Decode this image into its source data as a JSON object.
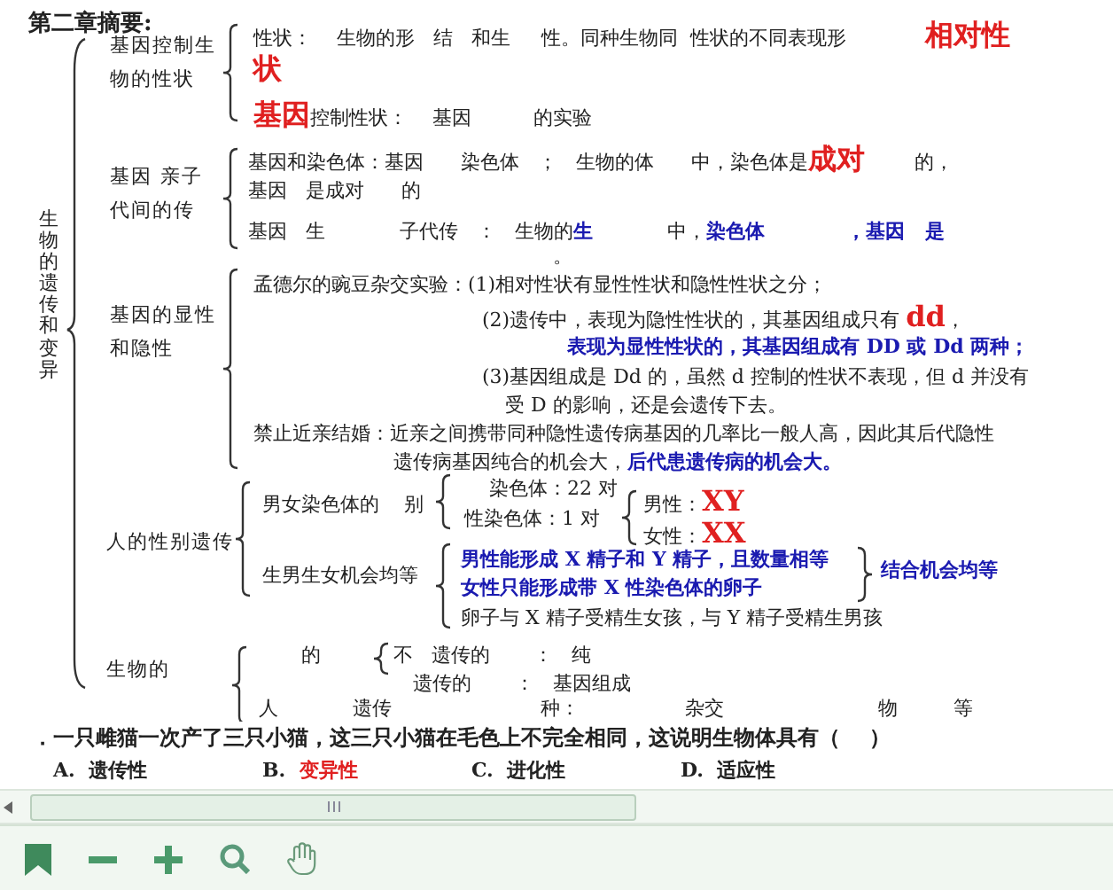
{
  "title": "第二章摘要:",
  "topic": "生物的遗传和变异",
  "sections": [
    {
      "label": "基因控制生物的性状",
      "lines": [
        [
          {
            "text": "性状：    生物的形   结   和生     性。同种生物同  性状的不同表现形",
            "kind": "text"
          },
          {
            "text": "        相对性",
            "kind": "key"
          }
        ],
        [
          {
            "text": "状",
            "kind": "key"
          }
        ],
        [
          {
            "text": "基因",
            "kind": "key"
          },
          {
            "text": "控制性状：    基因          的实验",
            "kind": "text"
          }
        ]
      ]
    },
    {
      "label": "基因  亲子代间的传",
      "lines": [
        [
          {
            "text": "基因和染色体：基因      染色体   ；   生物的体      中，染色体是",
            "kind": "text"
          },
          {
            "text": "成对",
            "kind": "key"
          },
          {
            "text": "        的，",
            "kind": "text"
          }
        ],
        [
          {
            "text": "基因   是成对      的",
            "kind": "text"
          }
        ],
        [
          {
            "text": "基因   生            子代传   ：   生物的",
            "kind": "text"
          },
          {
            "text": "生",
            "kind": "note"
          },
          {
            "text": "            中，",
            "kind": "text"
          },
          {
            "text": "染色体",
            "kind": "note"
          },
          {
            "text": "            ，基因   是",
            "kind": "note"
          }
        ],
        [
          {
            "text": "。",
            "kind": "text"
          }
        ]
      ]
    },
    {
      "label": "基因的显性和隐性",
      "lines": [
        [
          {
            "text": "孟德尔的豌豆杂交实验：(1)相对性状有显性性状和隐性性状之分；",
            "kind": "text"
          }
        ],
        [
          {
            "text": "(2)遗传中，表现为隐性性状的，其基因组成只有 ",
            "kind": "text"
          },
          {
            "text": "dd",
            "kind": "key"
          },
          {
            "text": "，",
            "kind": "text"
          }
        ],
        [
          {
            "text": "表现为显性性状的，其基因组成有 DD 或 Dd 两种；",
            "kind": "note"
          }
        ],
        [
          {
            "text": "(3)基因组成是 Dd 的，虽然 d 控制的性状不表现，但 d 并没有",
            "kind": "text"
          }
        ],
        [
          {
            "text": "受 D 的影响，还是会遗传下去。",
            "kind": "text"
          }
        ],
        [
          {
            "text": "禁止近亲结婚：近亲之间携带同种隐性遗传病基因的几率比一般人高，因此其后代隐性",
            "kind": "text"
          }
        ],
        [
          {
            "text": "遗传病基因纯合的机会大，",
            "kind": "text"
          },
          {
            "text": "后代患遗传病的机会大。",
            "kind": "note"
          }
        ]
      ]
    },
    {
      "label": "人的性别遗传",
      "lines": [
        [
          {
            "text": "男女染色体的    别",
            "kind": "text"
          }
        ],
        [
          {
            "text": "    染色体：22 对",
            "kind": "text"
          }
        ],
        [
          {
            "text": "性染色体：1 对",
            "kind": "text"
          }
        ],
        [
          {
            "text": "男性：",
            "kind": "text"
          },
          {
            "text": "XY",
            "kind": "key"
          }
        ],
        [
          {
            "text": "女性：",
            "kind": "text"
          },
          {
            "text": "XX",
            "kind": "key"
          }
        ],
        [
          {
            "text": "生男生女机会均等",
            "kind": "text"
          }
        ],
        [
          {
            "text": "男性能形成 X 精子和 Y 精子，且数量相等",
            "kind": "note"
          }
        ],
        [
          {
            "text": "女性只能形成带 X 性染色体的卵子",
            "kind": "note"
          }
        ],
        [
          {
            "text": "结合机会均等",
            "kind": "note"
          }
        ],
        [
          {
            "text": "卵子与 X 精子受精生女孩，与 Y 精子受精生男孩",
            "kind": "text"
          }
        ]
      ]
    },
    {
      "label": "生物的",
      "lines": [
        [
          {
            "text": "的",
            "kind": "text"
          }
        ],
        [
          {
            "text": "不   遗传的       ：   纯",
            "kind": "text"
          }
        ],
        [
          {
            "text": "遗传的       ：   基因组成",
            "kind": "text"
          }
        ],
        [
          {
            "text": "人            遗传                        种：                 杂交                         物         等",
            "kind": "text"
          }
        ]
      ]
    }
  ],
  "question": {
    "text": "．一只雌猫一次产了三只小猫，这三只小猫在毛色上不完全相同，这说明生物体具有（    ）",
    "options": [
      {
        "letter": "A.",
        "text": "遗传性",
        "selected": false
      },
      {
        "letter": "B.",
        "text": "变异性",
        "selected": true
      },
      {
        "letter": "C.",
        "text": "进化性",
        "selected": false
      },
      {
        "letter": "D.",
        "text": "适应性",
        "selected": false
      }
    ]
  }
}
